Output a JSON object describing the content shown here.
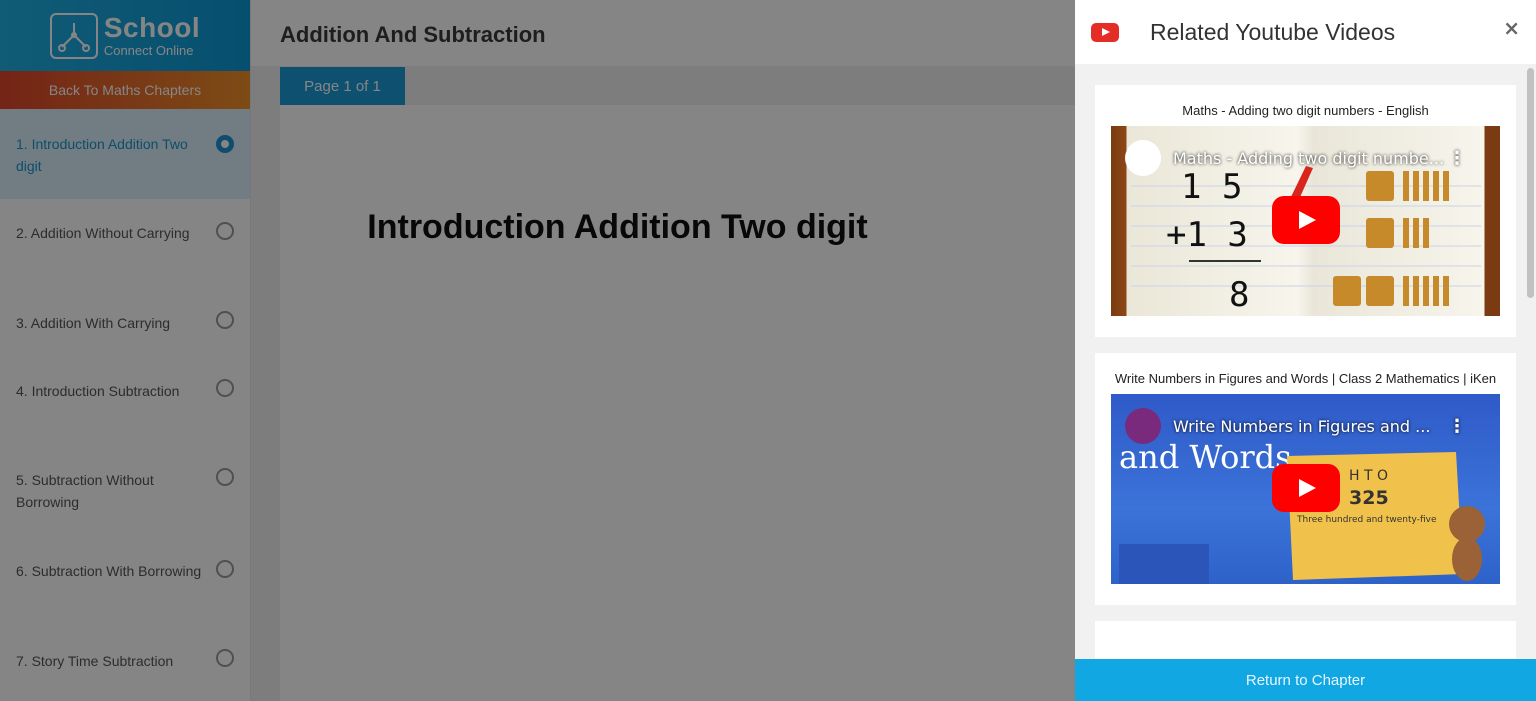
{
  "brand": {
    "name": "School",
    "sub": "Connect Online"
  },
  "sidebar": {
    "back_label": "Back To Maths Chapters",
    "chapters": [
      {
        "label": "1. Introduction Addition Two digit",
        "active": true
      },
      {
        "label": "2. Addition Without Carrying",
        "active": false
      },
      {
        "label": "3. Addition With Carrying",
        "active": false
      },
      {
        "label": "4. Introduction Subtraction",
        "active": false
      },
      {
        "label": "5. Subtraction Without Borrowing",
        "active": false
      },
      {
        "label": "6. Subtraction With Borrowing",
        "active": false
      },
      {
        "label": "7. Story Time Subtraction",
        "active": false
      }
    ]
  },
  "main": {
    "title": "Addition And Subtraction",
    "page_label": "Page 1 of 1",
    "heading": "Introduction Addition Two digit"
  },
  "panel": {
    "title": "Related Youtube Videos",
    "close": "×",
    "videos": [
      {
        "title": "Maths - Adding two digit numbers - English",
        "thumb_caption": "Maths - Adding two digit numbe..."
      },
      {
        "title": "Write Numbers in Figures and Words | Class 2 Mathematics | iKen",
        "thumb_caption": "Write Numbers in Figures and ..."
      }
    ],
    "return_label": "Return to Chapter"
  },
  "colors": {
    "brand": "#0d97d4",
    "back_button": "#e0452b",
    "accent": "#1b9ad6",
    "youtube_red": "#ff0000",
    "return_button": "#10a7e3"
  },
  "icons": [
    "school-connect-logo",
    "radio-icon",
    "youtube-icon",
    "close-icon",
    "play-icon",
    "more-options-icon"
  ]
}
